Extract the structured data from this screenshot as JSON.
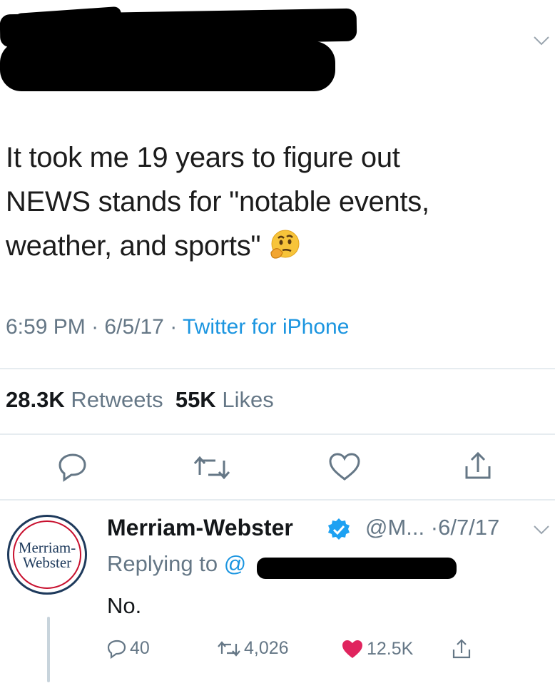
{
  "tweet": {
    "text_line1": "It took me 19 years to figure out",
    "text_line2": "NEWS stands for \"notable events,",
    "text_line3": "weather, and sports\"",
    "emoji": "thinking-face",
    "time": "6:59 PM",
    "date": "6/5/17",
    "separator": "·",
    "source": "Twitter for iPhone",
    "retweets_count": "28.3K",
    "retweets_label": "Retweets",
    "likes_count": "55K",
    "likes_label": "Likes"
  },
  "reply": {
    "avatar_line1": "Merriam-",
    "avatar_line2": "Webster",
    "name": "Merriam-Webster",
    "handle": "@M...",
    "date": "·6/7/17",
    "replying_prefix": "Replying to",
    "replying_at": "@",
    "text": "No.",
    "reply_count": "40",
    "retweet_count": "4,026",
    "like_count": "12.5K"
  },
  "colors": {
    "accent": "#1b95e0",
    "muted": "#657786",
    "like": "#e0245e",
    "verified": "#1da1f2"
  }
}
